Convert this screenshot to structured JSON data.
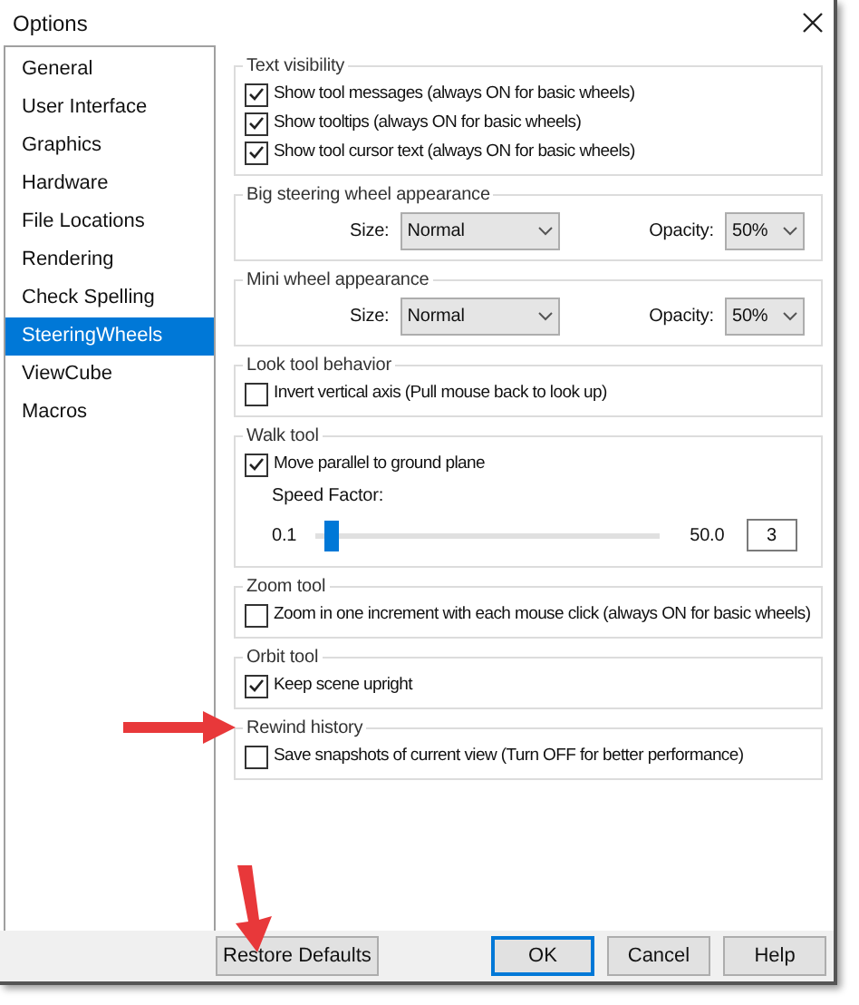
{
  "window": {
    "title": "Options"
  },
  "sidebar": {
    "items": [
      {
        "label": "General",
        "selected": false
      },
      {
        "label": "User Interface",
        "selected": false
      },
      {
        "label": "Graphics",
        "selected": false
      },
      {
        "label": "Hardware",
        "selected": false
      },
      {
        "label": "File Locations",
        "selected": false
      },
      {
        "label": "Rendering",
        "selected": false
      },
      {
        "label": "Check Spelling",
        "selected": false
      },
      {
        "label": "SteeringWheels",
        "selected": true
      },
      {
        "label": "ViewCube",
        "selected": false
      },
      {
        "label": "Macros",
        "selected": false
      }
    ]
  },
  "groups": [
    {
      "kind": "checks",
      "title": "Text visibility",
      "options": [
        {
          "label": "Show tool messages (always ON for basic wheels)",
          "checked": true
        },
        {
          "label": "Show tooltips (always ON for basic wheels)",
          "checked": true
        },
        {
          "label": "Show tool cursor text (always ON for basic wheels)",
          "checked": true
        }
      ]
    },
    {
      "kind": "appearance",
      "title": "Big steering wheel appearance",
      "size_label": "Size:",
      "size_value": "Normal",
      "opacity_label": "Opacity:",
      "opacity_value": "50%"
    },
    {
      "kind": "appearance",
      "title": "Mini wheel appearance",
      "size_label": "Size:",
      "size_value": "Normal",
      "opacity_label": "Opacity:",
      "opacity_value": "50%"
    },
    {
      "kind": "checks",
      "title": "Look tool behavior",
      "options": [
        {
          "label": "Invert vertical axis (Pull mouse back to look up)",
          "checked": false
        }
      ]
    },
    {
      "kind": "walk",
      "title": "Walk tool",
      "options": [
        {
          "label": "Move parallel to ground plane",
          "checked": true
        }
      ],
      "speed_label": "Speed Factor:",
      "min": "0.1",
      "max": "50.0",
      "level": 0.05,
      "value": "3"
    },
    {
      "kind": "checks",
      "title": "Zoom tool",
      "options": [
        {
          "label": "Zoom in one increment with each mouse click (always ON for basic wheels)",
          "checked": false
        }
      ]
    },
    {
      "kind": "checks",
      "title": "Orbit tool",
      "options": [
        {
          "label": "Keep scene upright",
          "checked": true
        }
      ]
    },
    {
      "kind": "checks",
      "title": "Rewind history",
      "options": [
        {
          "label": "Save snapshots of current view (Turn OFF for better performance)",
          "checked": false
        }
      ]
    }
  ],
  "restore_button": "Restore Defaults",
  "buttons": [
    {
      "label": "OK",
      "focused": true
    },
    {
      "label": "Cancel",
      "focused": false
    },
    {
      "label": "Help",
      "focused": false
    }
  ]
}
